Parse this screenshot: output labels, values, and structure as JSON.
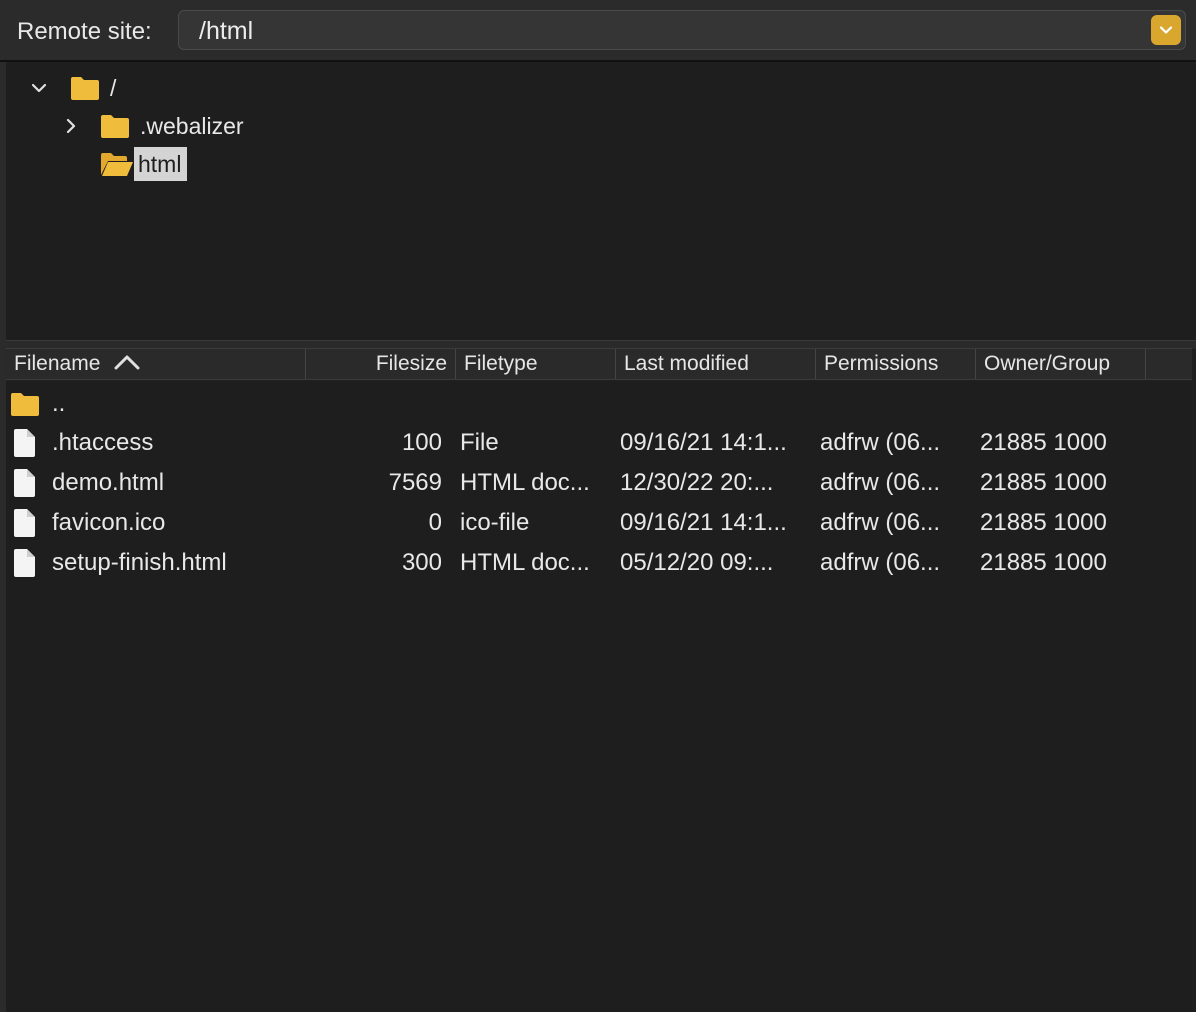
{
  "site_bar": {
    "label": "Remote site:",
    "path": "/html"
  },
  "tree": {
    "root": {
      "label": "/",
      "expanded": true
    },
    "children": [
      {
        "label": ".webalizer",
        "expanded": false,
        "selected": false
      },
      {
        "label": "html",
        "expanded": true,
        "selected": true
      }
    ]
  },
  "columns": {
    "filename": "Filename",
    "filesize": "Filesize",
    "filetype": "Filetype",
    "last_modified": "Last modified",
    "permissions": "Permissions",
    "owner_group": "Owner/Group",
    "sort_direction": "ascending"
  },
  "parent_row": {
    "name": ".."
  },
  "files": [
    {
      "name": ".htaccess",
      "size": "100",
      "type": "File",
      "modified": "09/16/21 14:1...",
      "permissions": "adfrw (06...",
      "owner": "21885 1000"
    },
    {
      "name": "demo.html",
      "size": "7569",
      "type": "HTML doc...",
      "modified": "12/30/22 20:...",
      "permissions": "adfrw (06...",
      "owner": "21885 1000"
    },
    {
      "name": "favicon.ico",
      "size": "0",
      "type": "ico-file",
      "modified": "09/16/21 14:1...",
      "permissions": "adfrw (06...",
      "owner": "21885 1000"
    },
    {
      "name": "setup-finish.html",
      "size": "300",
      "type": "HTML doc...",
      "modified": "05/12/20 09:...",
      "permissions": "adfrw (06...",
      "owner": "21885 1000"
    }
  ],
  "colors": {
    "accent": "#d9a72e",
    "folder": "#f0bc3c",
    "background": "#1f1f1f",
    "selection": "#d4d4d4"
  },
  "icons": {
    "folder": "folder-icon",
    "folder_open": "folder-open-icon",
    "file": "file-icon",
    "expand": "chevron-right-icon",
    "collapse": "chevron-down-icon",
    "dropdown": "chevron-down-icon",
    "sort": "sort-ascending-icon"
  }
}
